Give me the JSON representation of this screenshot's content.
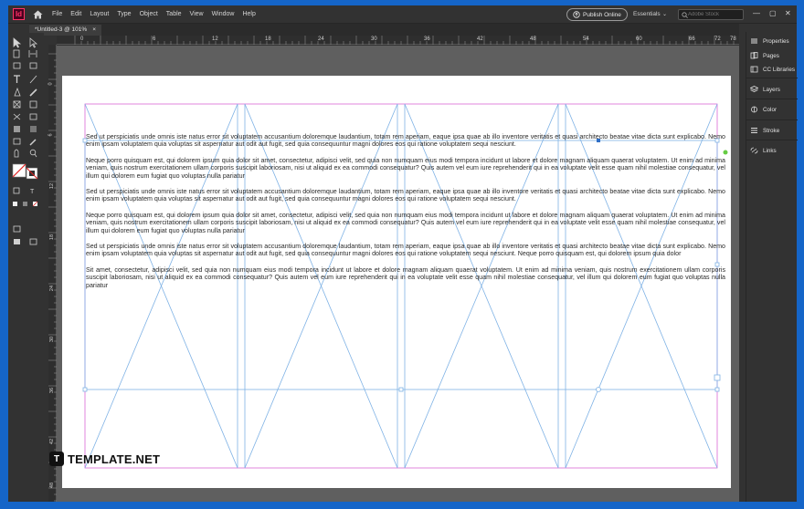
{
  "menu": {
    "logo": "Id",
    "items": [
      "File",
      "Edit",
      "Layout",
      "Type",
      "Object",
      "Table",
      "View",
      "Window",
      "Help"
    ],
    "publish_label": "Publish Online",
    "workspace": "Essentials",
    "search_placeholder": "Adobe Stock"
  },
  "document": {
    "tab_title": "*Untitled-3 @ 101%",
    "close": "×"
  },
  "ruler": {
    "h_labels": [
      "0",
      "6",
      "12",
      "18",
      "24",
      "30",
      "36",
      "42",
      "48",
      "54",
      "60",
      "66",
      "72",
      "78"
    ],
    "v_labels": [
      "0",
      "6",
      "12",
      "18",
      "24",
      "30",
      "36",
      "42",
      "48"
    ]
  },
  "panels": [
    "Properties",
    "Pages",
    "CC Libraries",
    "Layers",
    "Color",
    "Stroke",
    "Links"
  ],
  "text": [
    "Sed ut perspiciatis unde omnis iste natus error sit voluptatem accusantium doloremque laudantium, totam rem aperiam, eaque ipsa quae ab illo inventore veritatis et quasi architecto beatae vitae dicta sunt explicabo. Nemo enim ipsam voluptatem quia voluptas sit aspernatur aut odit aut fugit, sed quia consequuntur magni dolores eos qui ratione voluptatem sequi nesciunt.",
    "Neque porro quisquam est, qui dolorem ipsum quia dolor sit amet, consectetur, adipisci velit, sed quia non numquam eius modi tempora incidunt ut labore et dolore magnam aliquam quaerat voluptatem. Ut enim ad minima veniam, quis nostrum exercitationem ullam corporis suscipit laboriosam, nisi ut aliquid ex ea commodi consequatur? Quis autem vel eum iure reprehenderit qui in ea voluptate velit esse quam nihil molestiae consequatur, vel illum qui dolorem eum fugiat quo voluptas nulla pariatur",
    "Sed ut perspiciatis unde omnis iste natus error sit voluptatem accusantium doloremque laudantium, totam rem aperiam, eaque ipsa quae ab illo inventore veritatis et quasi architecto beatae vitae dicta sunt explicabo. Nemo enim ipsam voluptatem quia voluptas sit aspernatur aut odit aut fugit, sed quia consequuntur magni dolores eos qui ratione voluptatem sequi nesciunt.",
    "Neque porro quisquam est, qui dolorem ipsum quia dolor sit amet, consectetur, adipisci velit, sed quia non numquam eius modi tempora incidunt ut labore et dolore magnam aliquam quaerat voluptatem. Ut enim ad minima veniam, quis nostrum exercitationem ullam corporis suscipit laboriosam, nisi ut aliquid ex ea commodi consequatur? Quis autem vel eum iure reprehenderit qui in ea voluptate velit esse quam nihil molestiae consequatur, vel illum qui dolorem eum fugiat quo voluptas nulla pariatur",
    "Sed ut perspiciatis unde omnis iste natus error sit voluptatem accusantium doloremque laudantium, totam rem aperiam, eaque ipsa quae ab illo inventore veritatis et quasi architecto beatae vitae dicta sunt explicabo. Nemo enim ipsam voluptatem quia voluptas sit aspernatur aut odit aut fugit, sed quia consequuntur magni dolores eos qui ratione voluptatem sequi nesciunt. Neque porro quisquam est, qui dolorem ipsum quia dolor",
    "Sit amet, consectetur, adipisci velit, sed quia non numquam eius modi tempora incidunt ut labore et dolore magnam aliquam quaerat voluptatem. Ut enim ad minima veniam, quis nostrum exercitationem ullam corporis suscipit laboriosam, nisi ut aliquid ex ea commodi consequatur? Quis autem vel eum iure reprehenderit qui in ea voluptate velit esse quam nihil molestiae consequatur, vel illum qui dolorem eum fugiat quo voluptas nulla pariatur"
  ],
  "watermark": {
    "icon": "T",
    "text": "TEMPLATE.NET"
  },
  "colors": {
    "accent": "#1565c8",
    "frame": "#d966d6",
    "guide": "#7fb2e5"
  }
}
